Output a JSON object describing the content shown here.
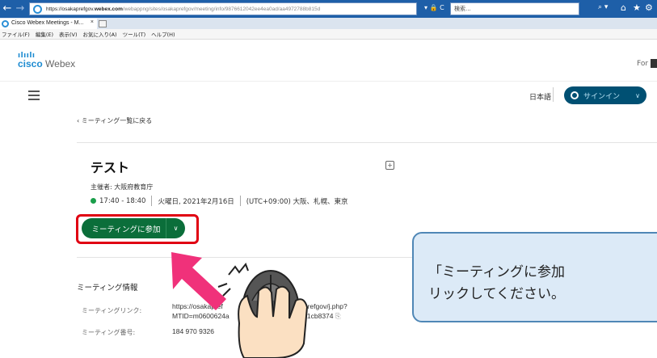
{
  "browser": {
    "url_prefix": "https://osakaprefgov.",
    "url_domain": "webex.com",
    "url_suffix": "/webappng/sites/osakaprefgov/meeting/info/9876612042ee4ea0ad/aa4972788b815d",
    "search_text": "検索...",
    "tab_title": "Cisco Webex Meetings - M...",
    "tab_close": "×",
    "menu": [
      "ファイル(F)",
      "編集(E)",
      "表示(V)",
      "お気に入り(A)",
      "ツール(T)",
      "ヘルプ(H)"
    ]
  },
  "header": {
    "logo_bars": "ılıılı",
    "logo_cisco": "cisco",
    "logo_webex": "Webex",
    "right_text": "For",
    "language": "日本語",
    "signin_label": "サインイン"
  },
  "page": {
    "back_link": "‹ ミーティング一覧に戻る",
    "meeting_title": "テスト",
    "host": "主催者: 大阪府教育庁",
    "time": "17:40 - 18:40",
    "date": "火曜日, 2021年2月16日",
    "timezone": "(UTC+09:00) 大阪、札幌、東京",
    "join_button": "ミーティングに参加",
    "info_section_title": "ミーティング情報",
    "link_label": "ミーティングリンク:",
    "link_value_line1": "https://osakapref",
    "link_value_line1_end": "prefgov/j.php?",
    "link_value_line2": "MTID=m0600624a",
    "link_value_line2_end": "c1cb8374",
    "number_label": "ミーティング番号:",
    "number_value": "184 970 9326"
  },
  "instruction": {
    "line1": "「ミーティングに参加",
    "line2": "リックしてください。"
  },
  "colors": {
    "join_button": "#0b6e3a",
    "highlight": "#e00012",
    "arrow": "#f0317a",
    "callout_bg": "#dceaf7"
  }
}
